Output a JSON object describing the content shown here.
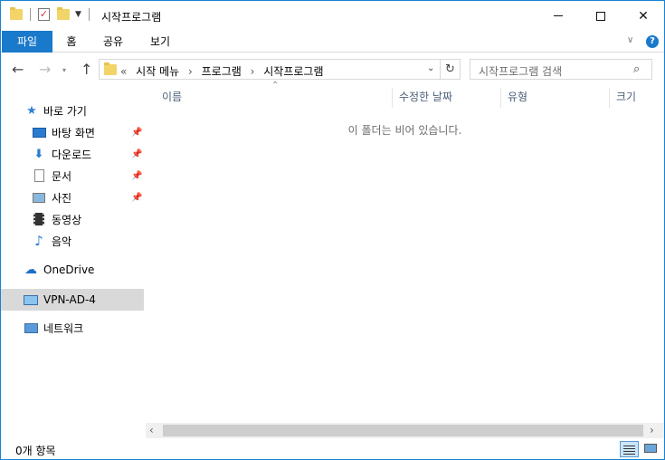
{
  "window": {
    "title": "시작프로그램",
    "controls": {
      "minimize": "—",
      "maximize": "☐",
      "close": "✕"
    }
  },
  "ribbon": {
    "tabs": [
      {
        "label": "파일",
        "active": true
      },
      {
        "label": "홈"
      },
      {
        "label": "공유"
      },
      {
        "label": "보기"
      }
    ],
    "help_label": "?"
  },
  "address": {
    "overflow": "«",
    "crumbs": [
      "시작 메뉴",
      "프로그램",
      "시작프로그램"
    ]
  },
  "search": {
    "placeholder": "시작프로그램 검색"
  },
  "nav_pane": {
    "quick_access": "바로 가기",
    "pinned": [
      {
        "label": "바탕 화면",
        "icon": "desktop-icon",
        "pinned": true
      },
      {
        "label": "다운로드",
        "icon": "download-icon",
        "pinned": true
      },
      {
        "label": "문서",
        "icon": "documents-icon",
        "pinned": true
      },
      {
        "label": "사진",
        "icon": "pictures-icon",
        "pinned": true
      },
      {
        "label": "동영상",
        "icon": "videos-icon",
        "pinned": false
      },
      {
        "label": "음악",
        "icon": "music-icon",
        "pinned": false
      }
    ],
    "onedrive": "OneDrive",
    "this_pc": "VPN-AD-4",
    "network": "네트워크"
  },
  "columns": [
    "이름",
    "수정한 날짜",
    "유형",
    "크기"
  ],
  "empty_message": "이 폴더는 비어 있습니다.",
  "status": {
    "item_count": "0개 항목"
  },
  "colors": {
    "accent": "#1979ca",
    "selected_nav": "#d9d9d9",
    "folder": "#f2d468"
  }
}
